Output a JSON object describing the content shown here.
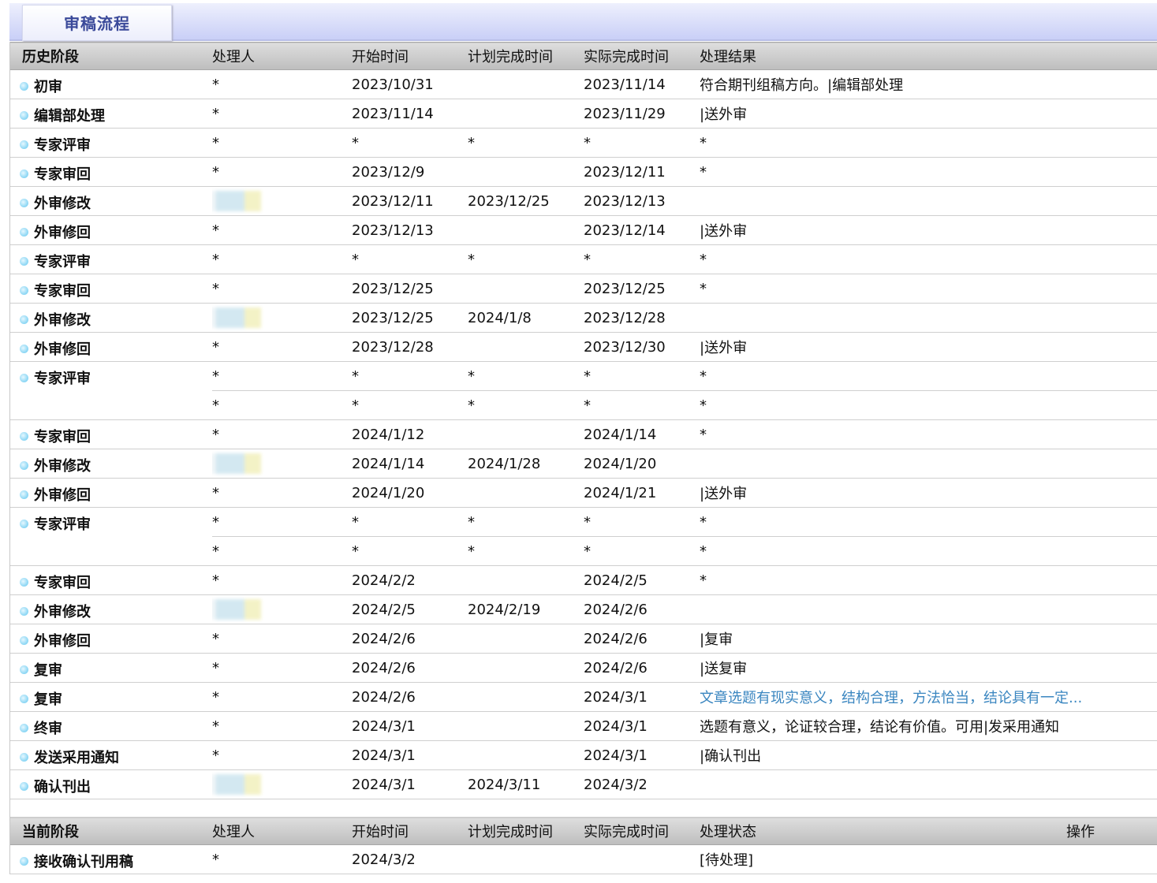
{
  "tab": {
    "label": "审稿流程"
  },
  "history": {
    "headers": [
      "历史阶段",
      "处理人",
      "开始时间",
      "计划完成时间",
      "实际完成时间",
      "处理结果"
    ],
    "rows": [
      {
        "stage": "初审",
        "subs": [
          {
            "handler": "*",
            "start": "2023/10/31",
            "planned": "",
            "actual": "2023/11/14",
            "result": "符合期刊组稿方向。|编辑部处理"
          }
        ]
      },
      {
        "stage": "编辑部处理",
        "subs": [
          {
            "handler": "*",
            "start": "2023/11/14",
            "planned": "",
            "actual": "2023/11/29",
            "result": "|送外审"
          }
        ]
      },
      {
        "stage": "专家评审",
        "subs": [
          {
            "handler": "*",
            "start": "*",
            "planned": "*",
            "actual": "*",
            "result": "*"
          }
        ]
      },
      {
        "stage": "专家审回",
        "subs": [
          {
            "handler": "*",
            "start": "2023/12/9",
            "planned": "",
            "actual": "2023/12/11",
            "result": "*"
          }
        ]
      },
      {
        "stage": "外审修改",
        "subs": [
          {
            "handler": "",
            "blurred": true,
            "start": "2023/12/11",
            "planned": "2023/12/25",
            "actual": "2023/12/13",
            "result": ""
          }
        ]
      },
      {
        "stage": "外审修回",
        "subs": [
          {
            "handler": "*",
            "start": "2023/12/13",
            "planned": "",
            "actual": "2023/12/14",
            "result": "|送外审"
          }
        ]
      },
      {
        "stage": "专家评审",
        "subs": [
          {
            "handler": "*",
            "start": "*",
            "planned": "*",
            "actual": "*",
            "result": "*"
          }
        ]
      },
      {
        "stage": "专家审回",
        "subs": [
          {
            "handler": "*",
            "start": "2023/12/25",
            "planned": "",
            "actual": "2023/12/25",
            "result": "*"
          }
        ]
      },
      {
        "stage": "外审修改",
        "subs": [
          {
            "handler": "",
            "blurred": true,
            "start": "2023/12/25",
            "planned": "2024/1/8",
            "actual": "2023/12/28",
            "result": ""
          }
        ]
      },
      {
        "stage": "外审修回",
        "subs": [
          {
            "handler": "*",
            "start": "2023/12/28",
            "planned": "",
            "actual": "2023/12/30",
            "result": "|送外审"
          }
        ]
      },
      {
        "stage": "专家评审",
        "subs": [
          {
            "handler": "*",
            "start": "*",
            "planned": "*",
            "actual": "*",
            "result": "*"
          },
          {
            "handler": "*",
            "start": "*",
            "planned": "*",
            "actual": "*",
            "result": "*"
          }
        ]
      },
      {
        "stage": "专家审回",
        "subs": [
          {
            "handler": "*",
            "start": "2024/1/12",
            "planned": "",
            "actual": "2024/1/14",
            "result": "*"
          }
        ]
      },
      {
        "stage": "外审修改",
        "subs": [
          {
            "handler": "",
            "blurred": true,
            "start": "2024/1/14",
            "planned": "2024/1/28",
            "actual": "2024/1/20",
            "result": ""
          }
        ]
      },
      {
        "stage": "外审修回",
        "subs": [
          {
            "handler": "*",
            "start": "2024/1/20",
            "planned": "",
            "actual": "2024/1/21",
            "result": "|送外审"
          }
        ]
      },
      {
        "stage": "专家评审",
        "subs": [
          {
            "handler": "*",
            "start": "*",
            "planned": "*",
            "actual": "*",
            "result": "*"
          },
          {
            "handler": "*",
            "start": "*",
            "planned": "*",
            "actual": "*",
            "result": "*"
          }
        ]
      },
      {
        "stage": "专家审回",
        "subs": [
          {
            "handler": "*",
            "start": "2024/2/2",
            "planned": "",
            "actual": "2024/2/5",
            "result": "*"
          }
        ]
      },
      {
        "stage": "外审修改",
        "subs": [
          {
            "handler": "",
            "blurred": true,
            "start": "2024/2/5",
            "planned": "2024/2/19",
            "actual": "2024/2/6",
            "result": ""
          }
        ]
      },
      {
        "stage": "外审修回",
        "subs": [
          {
            "handler": "*",
            "start": "2024/2/6",
            "planned": "",
            "actual": "2024/2/6",
            "result": "|复审"
          }
        ]
      },
      {
        "stage": "复审",
        "subs": [
          {
            "handler": "*",
            "start": "2024/2/6",
            "planned": "",
            "actual": "2024/2/6",
            "result": "|送复审"
          }
        ]
      },
      {
        "stage": "复审",
        "subs": [
          {
            "handler": "*",
            "start": "2024/2/6",
            "planned": "",
            "actual": "2024/3/1",
            "result": "文章选题有现实意义，结构合理，方法恰当，结论具有一定...",
            "link": true
          }
        ]
      },
      {
        "stage": "终审",
        "subs": [
          {
            "handler": "*",
            "start": "2024/3/1",
            "planned": "",
            "actual": "2024/3/1",
            "result": "选题有意义，论证较合理，结论有价值。可用|发采用通知"
          }
        ]
      },
      {
        "stage": "发送采用通知",
        "subs": [
          {
            "handler": "*",
            "start": "2024/3/1",
            "planned": "",
            "actual": "2024/3/1",
            "result": "|确认刊出"
          }
        ]
      },
      {
        "stage": "确认刊出",
        "subs": [
          {
            "handler": "",
            "blurred": true,
            "start": "2024/3/1",
            "planned": "2024/3/11",
            "actual": "2024/3/2",
            "result": ""
          }
        ]
      }
    ]
  },
  "current": {
    "headers": [
      "当前阶段",
      "处理人",
      "开始时间",
      "计划完成时间",
      "实际完成时间",
      "处理状态",
      "操作"
    ],
    "rows": [
      {
        "stage": "接收确认刊用稿",
        "handler": "*",
        "start": "2024/3/2",
        "planned": "",
        "actual": "",
        "status": "[待处理]",
        "action": ""
      }
    ]
  }
}
